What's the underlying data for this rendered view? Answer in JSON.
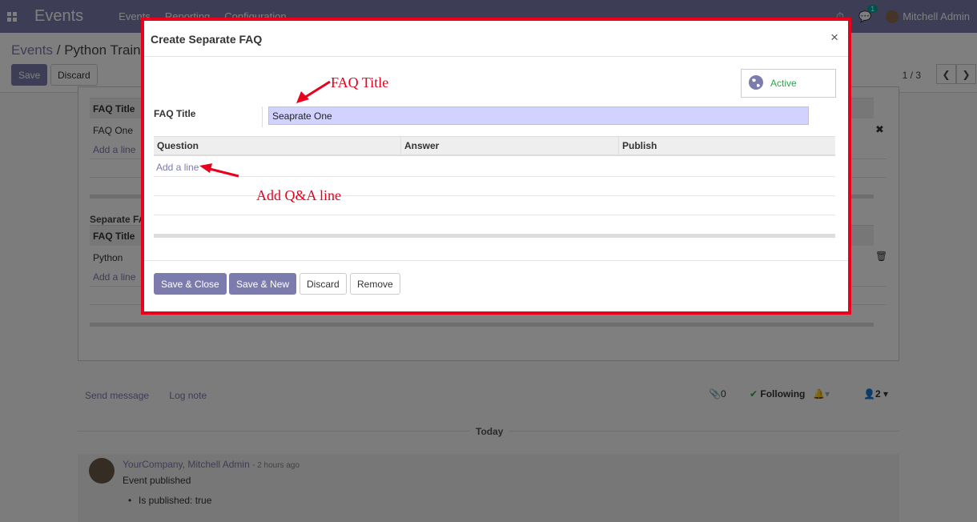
{
  "navbar": {
    "app_title": "Events",
    "menu": [
      "Events",
      "Reporting",
      "Configuration"
    ],
    "chat_badge": "1",
    "user_name": "Mitchell Admin"
  },
  "control_panel": {
    "breadcrumb_root": "Events",
    "breadcrumb_sep": "/",
    "breadcrumb_current": "Python Traini",
    "save_label": "Save",
    "discard_label": "Discard",
    "pager": "1 / 3"
  },
  "background_form": {
    "common_faq": {
      "header": "FAQ Title",
      "rows": [
        "FAQ One"
      ],
      "add_line": "Add a line"
    },
    "separate_faq": {
      "section_title": "Separate FA",
      "header": "FAQ Title",
      "rows": [
        "Python"
      ],
      "add_line": "Add a line"
    }
  },
  "chatter": {
    "send_message": "Send message",
    "log_note": "Log note",
    "attachments": "0",
    "following": "Following",
    "followers": "2",
    "date_separator": "Today",
    "message": {
      "author": "YourCompany, Mitchell Admin",
      "time": "- 2 hours ago",
      "body": "Event published",
      "tracking": "Is published: true"
    }
  },
  "modal": {
    "title": "Create Separate FAQ",
    "close": "×",
    "status_label": "Active",
    "field_label": "FAQ Title",
    "field_value": "Seaprate One",
    "columns": [
      "Question",
      "Answer",
      "Publish"
    ],
    "add_line": "Add a line",
    "buttons": {
      "save_close": "Save & Close",
      "save_new": "Save & New",
      "discard": "Discard",
      "remove": "Remove"
    }
  },
  "annotations": {
    "faq_title": "FAQ Title",
    "add_qa": "Add Q&A line"
  },
  "colors": {
    "brand": "#7c7bad",
    "highlight": "#e8001c",
    "active": "#28a745"
  }
}
